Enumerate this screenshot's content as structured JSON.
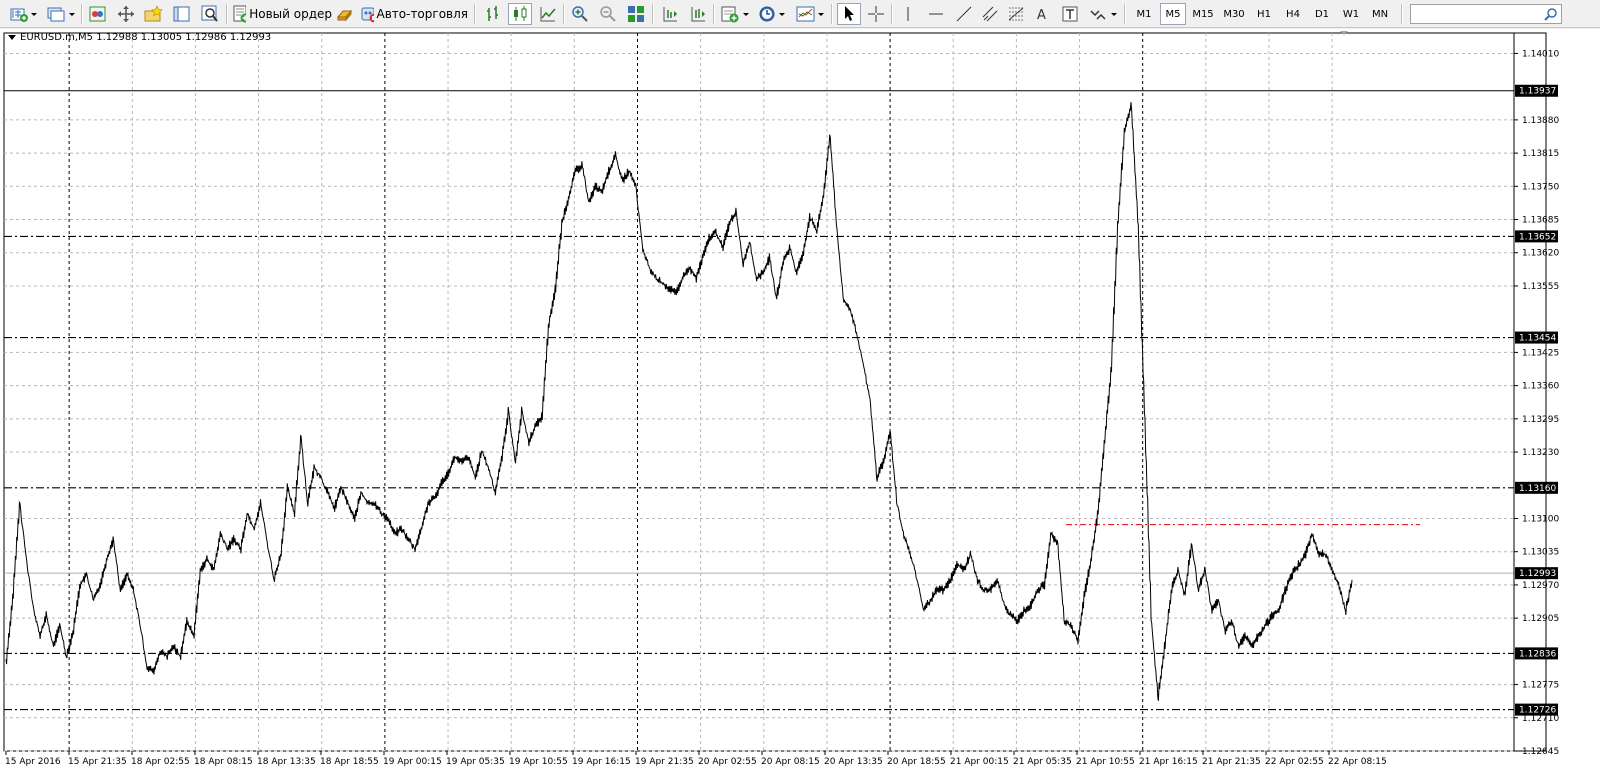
{
  "toolbar": {
    "new_order_label": "Новый ордер",
    "autotrading_label": "Авто-торговля",
    "timeframes": [
      "M1",
      "M5",
      "M15",
      "M30",
      "H1",
      "H4",
      "D1",
      "W1",
      "MN"
    ],
    "selected_timeframe": "M5",
    "search_placeholder": ""
  },
  "chart": {
    "symbol_info": "EURUSD.m,M5  1.12988 1.13005 1.12986 1.12993",
    "current_price": "1.12993",
    "colors": {
      "background": "#ffffff",
      "grid": "#b8b8b8",
      "line": "#000000",
      "level_line": "#000000",
      "resistance_line": "#e00000"
    }
  },
  "chart_data": {
    "type": "line",
    "symbol": "EURUSD.m",
    "timeframe": "M5",
    "ylim": [
      1.12645,
      1.1405
    ],
    "y_ticks": [
      1.1401,
      1.1388,
      1.13815,
      1.1375,
      1.13685,
      1.1362,
      1.13555,
      1.13425,
      1.1336,
      1.13295,
      1.1323,
      1.131,
      1.13035,
      1.1297,
      1.12905,
      1.12775,
      1.1271,
      1.12645
    ],
    "x_ticks": [
      "15 Apr 2016",
      "15 Apr 21:35",
      "18 Apr 02:55",
      "18 Apr 08:15",
      "18 Apr 13:35",
      "18 Apr 18:55",
      "19 Apr 00:15",
      "19 Apr 05:35",
      "19 Apr 10:55",
      "19 Apr 16:15",
      "19 Apr 21:35",
      "20 Apr 02:55",
      "20 Apr 08:15",
      "20 Apr 13:35",
      "20 Apr 18:55",
      "21 Apr 00:15",
      "21 Apr 05:35",
      "21 Apr 10:55",
      "21 Apr 16:15",
      "21 Apr 21:35",
      "22 Apr 02:55",
      "22 Apr 08:15"
    ],
    "day_separators": [
      "15 Apr 21:35",
      "19 Apr 00:15",
      "19 Apr 21:35",
      "20 Apr 18:55",
      "21 Apr 16:15"
    ],
    "levels": [
      1.13937,
      1.13652,
      1.13454,
      1.1316,
      1.12836,
      1.12726
    ],
    "resistance_level": 1.13088,
    "series": [
      {
        "values": [
          1.1282,
          1.1295,
          1.1313,
          1.1302,
          1.1293,
          1.1287,
          1.1291,
          1.1285,
          1.1289,
          1.1283,
          1.1288,
          1.1297,
          1.1299,
          1.1294,
          1.1297,
          1.1302,
          1.1306,
          1.1296,
          1.1299,
          1.1296,
          1.1289,
          1.1281,
          1.128,
          1.1284,
          1.1283,
          1.1285,
          1.1283,
          1.129,
          1.1287,
          1.13,
          1.1302,
          1.13,
          1.1307,
          1.1304,
          1.1306,
          1.1304,
          1.1311,
          1.1308,
          1.1313,
          1.1305,
          1.1298,
          1.1303,
          1.1316,
          1.1311,
          1.1326,
          1.1313,
          1.132,
          1.1318,
          1.1315,
          1.1312,
          1.1316,
          1.1313,
          1.131,
          1.1315,
          1.1313,
          1.1313,
          1.1311,
          1.131,
          1.1307,
          1.1308,
          1.1306,
          1.1304,
          1.1308,
          1.1313,
          1.1314,
          1.1317,
          1.1319,
          1.1322,
          1.1321,
          1.1322,
          1.1318,
          1.1323,
          1.132,
          1.1315,
          1.1322,
          1.1331,
          1.1321,
          1.1331,
          1.1325,
          1.1328,
          1.133,
          1.1348,
          1.1355,
          1.1368,
          1.1373,
          1.1378,
          1.1379,
          1.1372,
          1.1375,
          1.1374,
          1.1378,
          1.1381,
          1.1376,
          1.1378,
          1.1375,
          1.1363,
          1.1359,
          1.1357,
          1.1356,
          1.1355,
          1.1354,
          1.1357,
          1.1359,
          1.1357,
          1.1361,
          1.1365,
          1.1366,
          1.1363,
          1.1368,
          1.137,
          1.136,
          1.1364,
          1.1357,
          1.1358,
          1.1361,
          1.1353,
          1.136,
          1.1363,
          1.1358,
          1.1362,
          1.1369,
          1.1366,
          1.1373,
          1.1385,
          1.1367,
          1.1353,
          1.1351,
          1.1346,
          1.134,
          1.1333,
          1.1318,
          1.1321,
          1.1327,
          1.1313,
          1.1307,
          1.1303,
          1.1298,
          1.1292,
          1.1294,
          1.1296,
          1.1296,
          1.1298,
          1.1301,
          1.13,
          1.1303,
          1.1298,
          1.1296,
          1.1296,
          1.1298,
          1.1293,
          1.1291,
          1.129,
          1.1292,
          1.1293,
          1.1296,
          1.1297,
          1.1307,
          1.1305,
          1.129,
          1.1289,
          1.1286,
          1.1295,
          1.1302,
          1.1311,
          1.1325,
          1.1339,
          1.1368,
          1.1386,
          1.1391,
          1.1368,
          1.133,
          1.129,
          1.1275,
          1.1285,
          1.1296,
          1.13,
          1.1295,
          1.1305,
          1.1296,
          1.13,
          1.1292,
          1.1294,
          1.1288,
          1.129,
          1.1285,
          1.1287,
          1.1285,
          1.1287,
          1.1289,
          1.1291,
          1.1292,
          1.1296,
          1.1299,
          1.1301,
          1.1303,
          1.1307,
          1.1303,
          1.1303,
          1.13,
          1.1297,
          1.1292,
          1.1298
        ]
      }
    ]
  }
}
